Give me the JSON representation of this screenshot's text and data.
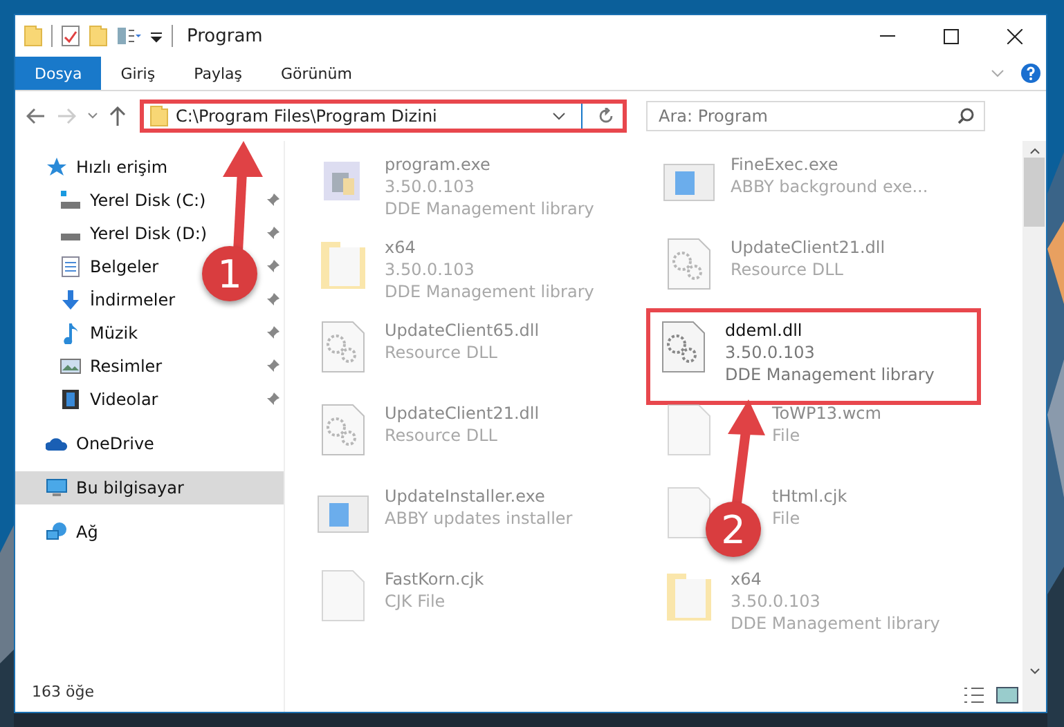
{
  "window": {
    "title": "Program"
  },
  "ribbon_tabs": [
    {
      "label": "Dosya",
      "selected": true
    },
    {
      "label": "Giriş",
      "selected": false
    },
    {
      "label": "Paylaş",
      "selected": false
    },
    {
      "label": "Görünüm",
      "selected": false
    }
  ],
  "address": {
    "value": "C:\\Program Files\\Program Dizini",
    "highlighted": true
  },
  "search": {
    "placeholder": "Ara: Program"
  },
  "sidebar": {
    "items": [
      {
        "label": "Hızlı erişim",
        "kind": "star",
        "selected": false,
        "children": [
          {
            "label": "Yerel Disk (C:)",
            "kind": "drive-c",
            "pinned": true,
            "selected": false
          },
          {
            "label": "Yerel Disk (D:)",
            "kind": "drive",
            "pinned": true,
            "selected": false
          },
          {
            "label": "Belgeler",
            "kind": "docs",
            "pinned": true,
            "selected": false
          },
          {
            "label": "İndirmeler",
            "kind": "download",
            "pinned": true,
            "selected": false
          },
          {
            "label": "Müzik",
            "kind": "music",
            "pinned": true,
            "selected": false
          },
          {
            "label": "Resimler",
            "kind": "pictures",
            "pinned": true,
            "selected": false
          },
          {
            "label": "Videolar",
            "kind": "videos",
            "pinned": true,
            "selected": false
          }
        ]
      },
      {
        "label": "OneDrive",
        "kind": "cloud",
        "selected": false
      },
      {
        "label": "Bu bilgisayar",
        "kind": "pc",
        "selected": true
      },
      {
        "label": "Ağ",
        "kind": "network",
        "selected": false
      }
    ]
  },
  "files": [
    {
      "name": "program.exe",
      "lines": [
        "3.50.0.103",
        "DDE Management library"
      ],
      "kind": "installer",
      "faded": true,
      "highlighted": false
    },
    {
      "name": "FineExec.exe",
      "lines": [
        "ABBY background exe..."
      ],
      "kind": "app",
      "faded": true,
      "highlighted": false
    },
    {
      "name": "x64",
      "lines": [
        "3.50.0.103",
        "DDE Management library"
      ],
      "kind": "folder",
      "faded": true,
      "highlighted": false
    },
    {
      "name": "UpdateClient21.dll",
      "lines": [
        "Resource DLL"
      ],
      "kind": "dll",
      "faded": true,
      "highlighted": false
    },
    {
      "name": "UpdateClient65.dll",
      "lines": [
        "Resource DLL"
      ],
      "kind": "dll",
      "faded": true,
      "highlighted": false
    },
    {
      "name": "ddeml.dll",
      "lines": [
        "3.50.0.103",
        "DDE Management library"
      ],
      "kind": "dll",
      "faded": false,
      "highlighted": true
    },
    {
      "name": "UpdateClient21.dll",
      "lines": [
        "Resource DLL"
      ],
      "kind": "dll",
      "faded": true,
      "highlighted": false
    },
    {
      "name": "ToWP13.wcm",
      "lines": [
        "File"
      ],
      "kind": "file",
      "faded": true,
      "highlighted": false,
      "covered": true
    },
    {
      "name": "UpdateInstaller.exe",
      "lines": [
        "ABBY updates installer"
      ],
      "kind": "app",
      "faded": true,
      "highlighted": false
    },
    {
      "name": "tHtml.cjk",
      "lines": [
        "File"
      ],
      "kind": "file",
      "faded": true,
      "highlighted": false,
      "covered": true
    },
    {
      "name": "FastKorn.cjk",
      "lines": [
        "CJK File"
      ],
      "kind": "file",
      "faded": true,
      "highlighted": false
    },
    {
      "name": "x64",
      "lines": [
        "3.50.0.103",
        "DDE Management library"
      ],
      "kind": "folder",
      "faded": true,
      "highlighted": false
    }
  ],
  "status_bar": {
    "count": "163 öğe"
  },
  "annotations": [
    {
      "number": "1"
    },
    {
      "number": "2"
    }
  ]
}
